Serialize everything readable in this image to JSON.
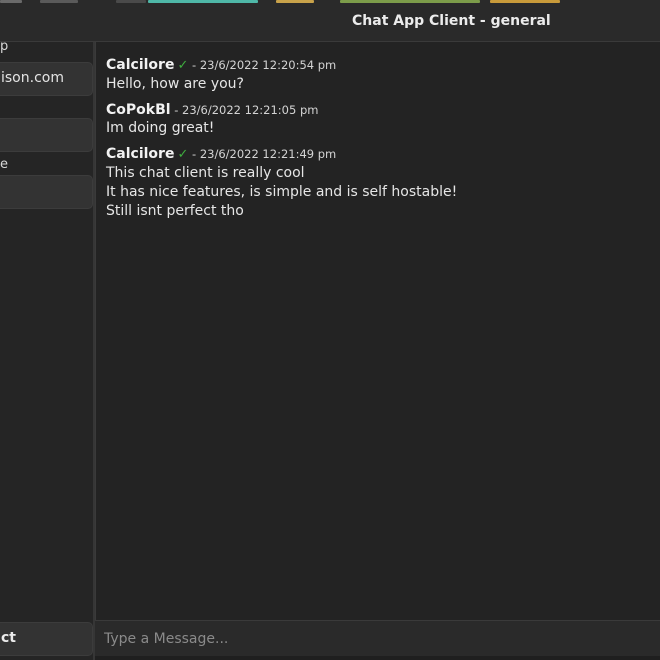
{
  "window": {
    "title": "Chat App Client - general"
  },
  "sidebar": {
    "label1": "p",
    "field1_value": "ison.com",
    "label2": "e",
    "connect_label": "ct"
  },
  "messages": [
    {
      "author": "Calcilore",
      "verified": true,
      "sep": " - ",
      "time": "23/6/2022 12:20:54 pm",
      "lines": [
        "Hello, how are you?"
      ]
    },
    {
      "author": "CoPokBl",
      "verified": false,
      "sep": " - ",
      "time": "23/6/2022 12:21:05 pm",
      "lines": [
        "Im doing great!"
      ]
    },
    {
      "author": "Calcilore",
      "verified": true,
      "sep": " - ",
      "time": "23/6/2022 12:21:49 pm",
      "lines": [
        "This chat client is really cool",
        "It has nice features, is simple and is self hostable!",
        "Still isnt perfect tho"
      ]
    }
  ],
  "composer": {
    "placeholder": "Type a Message..."
  },
  "icons": {
    "verified": "check-icon"
  },
  "colors": {
    "verified": "#3fae3f",
    "background": "#1f1f1f",
    "panel": "#333333"
  }
}
